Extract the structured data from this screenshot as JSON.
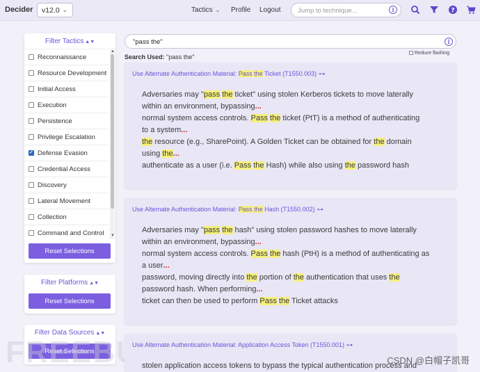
{
  "nav": {
    "brand": "Decider",
    "version": "v12.0",
    "tactics": "Tactics",
    "profile": "Profile",
    "logout": "Logout",
    "jump_placeholder": "Jump to technique..."
  },
  "sidebar": {
    "tactics_title": "Filter Tactics",
    "tactics": [
      {
        "label": "Reconnaissance",
        "checked": false
      },
      {
        "label": "Resource Development",
        "checked": false
      },
      {
        "label": "Initial Access",
        "checked": false
      },
      {
        "label": "Execution",
        "checked": false
      },
      {
        "label": "Persistence",
        "checked": false
      },
      {
        "label": "Privilege Escalation",
        "checked": false
      },
      {
        "label": "Defense Evasion",
        "checked": true
      },
      {
        "label": "Credential Access",
        "checked": false
      },
      {
        "label": "Discovery",
        "checked": false
      },
      {
        "label": "Lateral Movement",
        "checked": false
      },
      {
        "label": "Collection",
        "checked": false
      },
      {
        "label": "Command and Control",
        "checked": false
      }
    ],
    "reset_label": "Reset Selections",
    "platforms_title": "Filter Platforms",
    "datasources_title": "Filter Data Sources"
  },
  "search": {
    "value": "\"pass the\"",
    "used_label": "Search Used:",
    "used_value": "\"pass the\"",
    "reduce_flashing": "Reduce flashing"
  },
  "results": [
    {
      "title_pre": "Use Alternate Authentication Material: ",
      "title_hl1": "Pass",
      "title_mid": " ",
      "title_hl2": "the",
      "title_post": " Ticket (T1550.003)"
    },
    {
      "title_pre": "Use Alternate Authentication Material: ",
      "title_hl1": "Pass",
      "title_mid": " ",
      "title_hl2": "the",
      "title_post": " Hash (T1550.002)"
    },
    {
      "title": "Use Alternate Authentication Material: Application Access Token (T1550.001)",
      "body": "stolen application access tokens to bypass the typical authentication process and"
    }
  ],
  "watermark": "CSDN @白帽子凯哥",
  "bg_watermark": "FREEBUF",
  "colors": {
    "accent": "#7b5fe0",
    "highlight": "#f5f07c",
    "ellipsis": "#c0392b"
  }
}
